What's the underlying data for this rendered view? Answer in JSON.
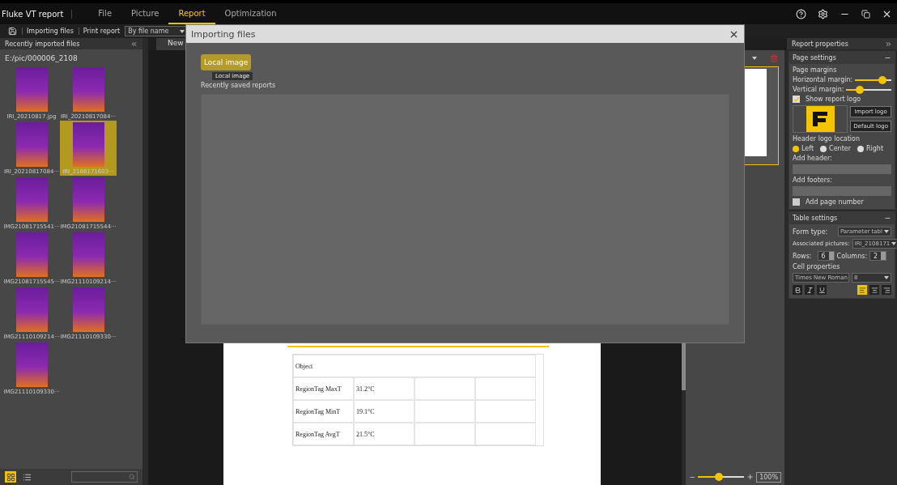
{
  "app": {
    "title": "Fluke VT report"
  },
  "menu_tabs": [
    {
      "label": "File",
      "selected": false
    },
    {
      "label": "Picture",
      "selected": false
    },
    {
      "label": "Report",
      "selected": true
    },
    {
      "label": "Optimization",
      "selected": false
    }
  ],
  "toolbar": {
    "buttons": [
      "Importing files",
      "Print report"
    ],
    "sort": "By file name"
  },
  "left_panel": {
    "title": "Recently imported files",
    "path": "E:/pic/000006_2108",
    "files": [
      {
        "name": "IRI_20210817.jpg",
        "selected": false
      },
      {
        "name": "IRI_20210817084···",
        "selected": false
      },
      {
        "name": "IRI_20210817084···",
        "selected": false
      },
      {
        "name": "IRI_2108171603···",
        "selected": true
      },
      {
        "name": "IMG21081715541···",
        "selected": false
      },
      {
        "name": "IMG21081715544···",
        "selected": false
      },
      {
        "name": "IMG21081715545···",
        "selected": false
      },
      {
        "name": "IMG21110109214···",
        "selected": false
      },
      {
        "name": "IMG21110109214···",
        "selected": false
      },
      {
        "name": "IMG21110109330···",
        "selected": false
      },
      {
        "name": "IMG21110109330···",
        "selected": false
      }
    ],
    "views": [
      {
        "kind": "grid",
        "selected": true
      },
      {
        "kind": "list",
        "selected": false
      }
    ]
  },
  "document": {
    "tab": "New",
    "table": {
      "header": "Object",
      "rows": [
        {
          "cells": [
            "RegionTag MaxT",
            "31.2°C"
          ]
        },
        {
          "cells": [
            "RegionTag MinT",
            "19.1°C"
          ]
        },
        {
          "cells": [
            "RegionTag AvgT",
            "21.5°C"
          ]
        }
      ]
    },
    "zoom": {
      "level": 0.45,
      "reading": "100%"
    }
  },
  "dialog": {
    "title": "Importing files",
    "button": "Local image",
    "tooltip": "Local image",
    "section": "Recently saved reports"
  },
  "report_properties": {
    "title": "Report properties",
    "page_settings": {
      "title": "Page settings",
      "margins_label": "Page margins",
      "margins": [
        {
          "label": "Horizontal margin:",
          "level": 0.75
        },
        {
          "label": "Vertical margin:",
          "level": 0.3
        }
      ],
      "show_logo": {
        "label": "Show report logo",
        "checked": true
      },
      "logo_buttons": [
        "Import logo",
        "Default logo"
      ],
      "logo_location_label": "Header logo location",
      "logo_location": [
        {
          "label": "Left",
          "selected": true
        },
        {
          "label": "Center",
          "selected": false
        },
        {
          "label": "Right",
          "selected": false
        }
      ],
      "header_label": "Add header:",
      "footer_label": "Add footers:",
      "page_number": {
        "label": "Add page number",
        "checked": false
      }
    },
    "table_settings": {
      "title": "Table settings",
      "form_type_label": "Form type:",
      "form_type": "Parameter tabl",
      "pictures_label": "Associated pictures:",
      "pictures": "IRI_2108171",
      "rows_label": "Rows:",
      "rows": "6",
      "columns_label": "Columns:",
      "columns": "2",
      "cell_label": "Cell properties",
      "font": "Times New Roman",
      "size": "8",
      "styles": [
        {
          "kind": "bold",
          "selected": false
        },
        {
          "kind": "italic",
          "selected": false
        },
        {
          "kind": "underline",
          "selected": false
        }
      ],
      "align": [
        {
          "kind": "left",
          "selected": true
        },
        {
          "kind": "center",
          "selected": false
        },
        {
          "kind": "right",
          "selected": false
        }
      ]
    }
  }
}
